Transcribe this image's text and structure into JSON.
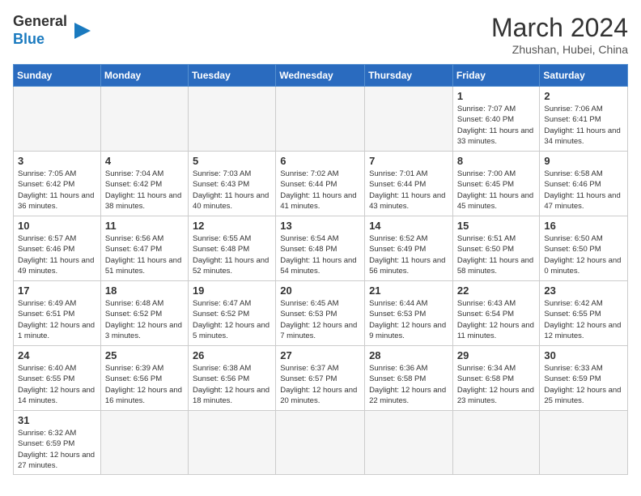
{
  "header": {
    "logo_general": "General",
    "logo_blue": "Blue",
    "title": "March 2024",
    "subtitle": "Zhushan, Hubei, China"
  },
  "days_of_week": [
    "Sunday",
    "Monday",
    "Tuesday",
    "Wednesday",
    "Thursday",
    "Friday",
    "Saturday"
  ],
  "weeks": [
    [
      {
        "day": "",
        "info": "",
        "empty": true
      },
      {
        "day": "",
        "info": "",
        "empty": true
      },
      {
        "day": "",
        "info": "",
        "empty": true
      },
      {
        "day": "",
        "info": "",
        "empty": true
      },
      {
        "day": "",
        "info": "",
        "empty": true
      },
      {
        "day": "1",
        "info": "Sunrise: 7:07 AM\nSunset: 6:40 PM\nDaylight: 11 hours\nand 33 minutes."
      },
      {
        "day": "2",
        "info": "Sunrise: 7:06 AM\nSunset: 6:41 PM\nDaylight: 11 hours\nand 34 minutes."
      }
    ],
    [
      {
        "day": "3",
        "info": "Sunrise: 7:05 AM\nSunset: 6:42 PM\nDaylight: 11 hours\nand 36 minutes."
      },
      {
        "day": "4",
        "info": "Sunrise: 7:04 AM\nSunset: 6:42 PM\nDaylight: 11 hours\nand 38 minutes."
      },
      {
        "day": "5",
        "info": "Sunrise: 7:03 AM\nSunset: 6:43 PM\nDaylight: 11 hours\nand 40 minutes."
      },
      {
        "day": "6",
        "info": "Sunrise: 7:02 AM\nSunset: 6:44 PM\nDaylight: 11 hours\nand 41 minutes."
      },
      {
        "day": "7",
        "info": "Sunrise: 7:01 AM\nSunset: 6:44 PM\nDaylight: 11 hours\nand 43 minutes."
      },
      {
        "day": "8",
        "info": "Sunrise: 7:00 AM\nSunset: 6:45 PM\nDaylight: 11 hours\nand 45 minutes."
      },
      {
        "day": "9",
        "info": "Sunrise: 6:58 AM\nSunset: 6:46 PM\nDaylight: 11 hours\nand 47 minutes."
      }
    ],
    [
      {
        "day": "10",
        "info": "Sunrise: 6:57 AM\nSunset: 6:46 PM\nDaylight: 11 hours\nand 49 minutes."
      },
      {
        "day": "11",
        "info": "Sunrise: 6:56 AM\nSunset: 6:47 PM\nDaylight: 11 hours\nand 51 minutes."
      },
      {
        "day": "12",
        "info": "Sunrise: 6:55 AM\nSunset: 6:48 PM\nDaylight: 11 hours\nand 52 minutes."
      },
      {
        "day": "13",
        "info": "Sunrise: 6:54 AM\nSunset: 6:48 PM\nDaylight: 11 hours\nand 54 minutes."
      },
      {
        "day": "14",
        "info": "Sunrise: 6:52 AM\nSunset: 6:49 PM\nDaylight: 11 hours\nand 56 minutes."
      },
      {
        "day": "15",
        "info": "Sunrise: 6:51 AM\nSunset: 6:50 PM\nDaylight: 11 hours\nand 58 minutes."
      },
      {
        "day": "16",
        "info": "Sunrise: 6:50 AM\nSunset: 6:50 PM\nDaylight: 12 hours\nand 0 minutes."
      }
    ],
    [
      {
        "day": "17",
        "info": "Sunrise: 6:49 AM\nSunset: 6:51 PM\nDaylight: 12 hours\nand 1 minute."
      },
      {
        "day": "18",
        "info": "Sunrise: 6:48 AM\nSunset: 6:52 PM\nDaylight: 12 hours\nand 3 minutes."
      },
      {
        "day": "19",
        "info": "Sunrise: 6:47 AM\nSunset: 6:52 PM\nDaylight: 12 hours\nand 5 minutes."
      },
      {
        "day": "20",
        "info": "Sunrise: 6:45 AM\nSunset: 6:53 PM\nDaylight: 12 hours\nand 7 minutes."
      },
      {
        "day": "21",
        "info": "Sunrise: 6:44 AM\nSunset: 6:53 PM\nDaylight: 12 hours\nand 9 minutes."
      },
      {
        "day": "22",
        "info": "Sunrise: 6:43 AM\nSunset: 6:54 PM\nDaylight: 12 hours\nand 11 minutes."
      },
      {
        "day": "23",
        "info": "Sunrise: 6:42 AM\nSunset: 6:55 PM\nDaylight: 12 hours\nand 12 minutes."
      }
    ],
    [
      {
        "day": "24",
        "info": "Sunrise: 6:40 AM\nSunset: 6:55 PM\nDaylight: 12 hours\nand 14 minutes."
      },
      {
        "day": "25",
        "info": "Sunrise: 6:39 AM\nSunset: 6:56 PM\nDaylight: 12 hours\nand 16 minutes."
      },
      {
        "day": "26",
        "info": "Sunrise: 6:38 AM\nSunset: 6:56 PM\nDaylight: 12 hours\nand 18 minutes."
      },
      {
        "day": "27",
        "info": "Sunrise: 6:37 AM\nSunset: 6:57 PM\nDaylight: 12 hours\nand 20 minutes."
      },
      {
        "day": "28",
        "info": "Sunrise: 6:36 AM\nSunset: 6:58 PM\nDaylight: 12 hours\nand 22 minutes."
      },
      {
        "day": "29",
        "info": "Sunrise: 6:34 AM\nSunset: 6:58 PM\nDaylight: 12 hours\nand 23 minutes."
      },
      {
        "day": "30",
        "info": "Sunrise: 6:33 AM\nSunset: 6:59 PM\nDaylight: 12 hours\nand 25 minutes."
      }
    ],
    [
      {
        "day": "31",
        "info": "Sunrise: 6:32 AM\nSunset: 6:59 PM\nDaylight: 12 hours\nand 27 minutes."
      },
      {
        "day": "",
        "info": "",
        "empty": true
      },
      {
        "day": "",
        "info": "",
        "empty": true
      },
      {
        "day": "",
        "info": "",
        "empty": true
      },
      {
        "day": "",
        "info": "",
        "empty": true
      },
      {
        "day": "",
        "info": "",
        "empty": true
      },
      {
        "day": "",
        "info": "",
        "empty": true
      }
    ]
  ]
}
